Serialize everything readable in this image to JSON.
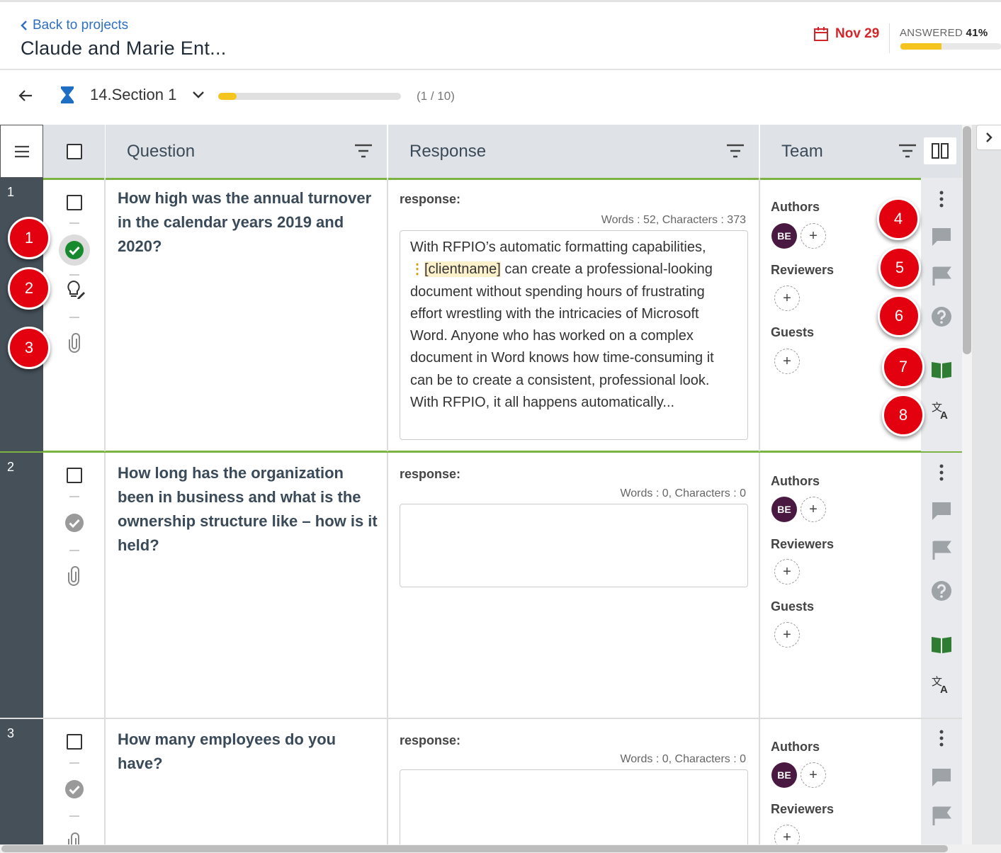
{
  "header": {
    "back_label": "Back to projects",
    "project_title": "Claude and Marie Ent...",
    "due_date": "Nov 29",
    "answered_label": "ANSWERED",
    "answered_percent": "41%",
    "answered_fraction": 0.41
  },
  "section": {
    "name": "14.Section 1",
    "count": "(1 / 10)",
    "progress_fraction": 0.1
  },
  "columns": {
    "question": "Question",
    "response": "Response",
    "team": "Team"
  },
  "rows": [
    {
      "num": "1",
      "question": "How high was the annual turnover in the calendar years 2019 and 2020?",
      "response_label": "response:",
      "word_count": "Words : 52, Characters : 373",
      "response_pre": "With RFPIO’s automatic formatting capabilities,",
      "response_tag": "[clientname]",
      "response_post": " can create a professional-looking document without spending hours of frustrating effort wrestling with the intricacies of Microsoft Word.  Anyone who has worked on a complex document in Word knows how time-consuming it can be to create a consistent, professional look. With RFPIO, it all happens automatically...",
      "authors_label": "Authors",
      "avatar": "BE",
      "reviewers_label": "Reviewers",
      "guests_label": "Guests"
    },
    {
      "num": "2",
      "question": "How long has the organization been in business and what is the ownership structure like – how is it held?",
      "response_label": "response:",
      "word_count": "Words : 0, Characters : 0",
      "authors_label": "Authors",
      "avatar": "BE",
      "reviewers_label": "Reviewers",
      "guests_label": "Guests"
    },
    {
      "num": "3",
      "question": "How many employees do you have?",
      "response_label": "response:",
      "word_count": "Words : 0, Characters : 0",
      "authors_label": "Authors",
      "avatar": "BE",
      "reviewers_label": "Reviewers"
    }
  ],
  "add_symbol": "+",
  "badges": [
    "1",
    "2",
    "3",
    "4",
    "5",
    "6",
    "7",
    "8"
  ],
  "icons": {
    "menu": "hamburger-icon",
    "filter": "filter-icon",
    "layout": "columns-layout-icon",
    "status": "check-circle-icon",
    "suggest": "lightbulb-edit-icon",
    "attach": "paperclip-icon",
    "more": "more-vertical-icon",
    "comment": "comment-icon",
    "flag": "flag-icon",
    "help": "question-icon",
    "library": "book-open-icon",
    "translate": "translate-icon"
  },
  "colors": {
    "accent_blue": "#2f6fbf",
    "due_red": "#d4262a",
    "progress_yellow": "#f5c51d",
    "selected_outline": "#7cb342",
    "badge_red": "#e3000f",
    "avatar_purple": "#4a1942",
    "library_green": "#2e7d32"
  }
}
